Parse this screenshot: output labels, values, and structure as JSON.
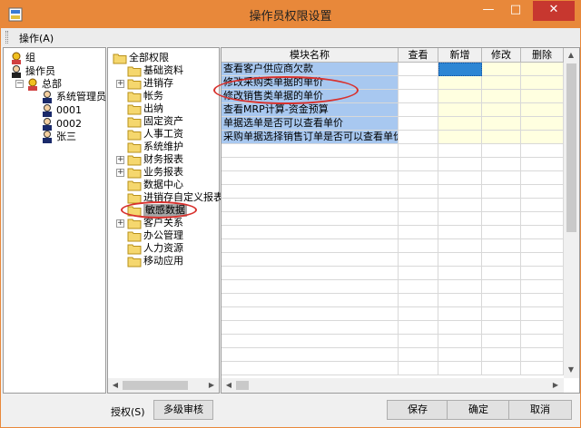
{
  "window": {
    "title": "操作员权限设置"
  },
  "menu": {
    "operation": "操作(A)"
  },
  "tree1": {
    "group": "组",
    "operators": "操作员",
    "hq": "总部",
    "users": [
      "系统管理员",
      "0001",
      "0002",
      "张三"
    ]
  },
  "tree2": {
    "root": "全部权限",
    "items": [
      "基础资料",
      "进销存",
      "帐务",
      "出纳",
      "固定资产",
      "人事工资",
      "系统维护",
      "财务报表",
      "业务报表",
      "数据中心",
      "进销存自定义报表",
      "敏感数据",
      "客户关系",
      "办公管理",
      "人力资源",
      "移动应用"
    ]
  },
  "grid": {
    "headers": [
      "模块名称",
      "查看",
      "新增",
      "修改",
      "删除"
    ],
    "rows": [
      "查看客户供应商欠款",
      "修改采购类单据的单价",
      "修改销售类单据的单价",
      "查看MRP计算-资金预算",
      "单据选单是否可以查看单价",
      "采购单据选择销售订单是否可以查看单价"
    ]
  },
  "bottom": {
    "auth_label": "授权(S)",
    "multi_review": "多级审核",
    "save": "保存",
    "ok": "确定",
    "cancel": "取消"
  },
  "colors": {
    "titlebar": "#e8883a",
    "close": "#c7372f",
    "selection": "#a8c8f0",
    "annotation": "#d8312d"
  }
}
